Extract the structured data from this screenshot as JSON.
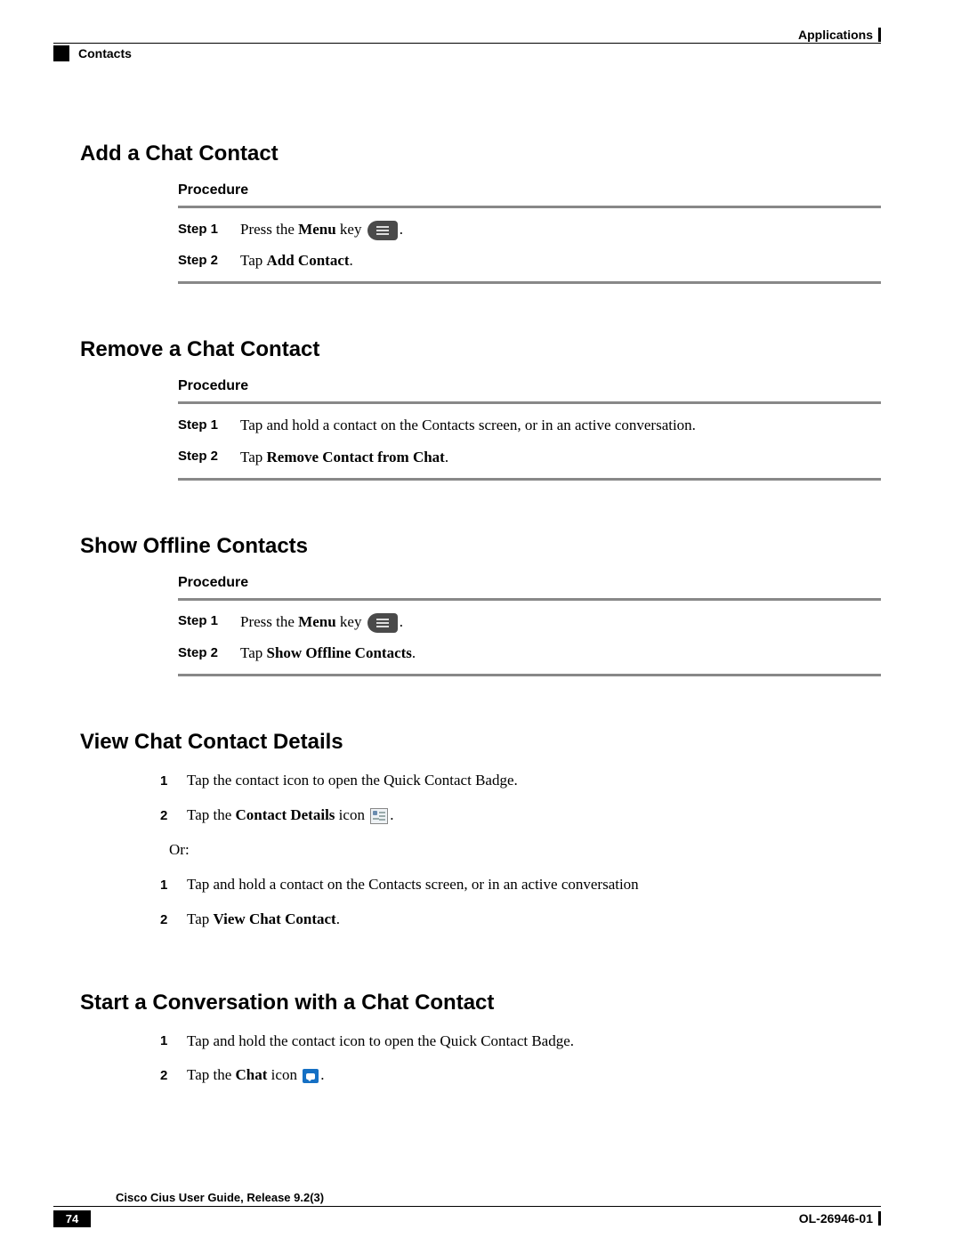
{
  "header": {
    "left": "Contacts",
    "right": "Applications"
  },
  "sections": {
    "add": {
      "title": "Add a Chat Contact",
      "procedure_label": "Procedure",
      "steps": [
        {
          "label": "Step 1",
          "prefix": "Press the ",
          "bold": "Menu",
          "suffix": " key ",
          "icon": "menu",
          "trail": "."
        },
        {
          "label": "Step 2",
          "prefix": "Tap ",
          "bold": "Add Contact",
          "suffix": ".",
          "icon": "",
          "trail": ""
        }
      ]
    },
    "remove": {
      "title": "Remove a Chat Contact",
      "procedure_label": "Procedure",
      "steps": [
        {
          "label": "Step 1",
          "prefix": "Tap and hold a contact on the Contacts screen, or in an active conversation.",
          "bold": "",
          "suffix": "",
          "icon": "",
          "trail": ""
        },
        {
          "label": "Step 2",
          "prefix": "Tap ",
          "bold": "Remove Contact from Chat",
          "suffix": ".",
          "icon": "",
          "trail": ""
        }
      ]
    },
    "offline": {
      "title": "Show Offline Contacts",
      "procedure_label": "Procedure",
      "steps": [
        {
          "label": "Step 1",
          "prefix": "Press the ",
          "bold": "Menu",
          "suffix": " key ",
          "icon": "menu",
          "trail": "."
        },
        {
          "label": "Step 2",
          "prefix": "Tap ",
          "bold": "Show Offline Contacts",
          "suffix": ".",
          "icon": "",
          "trail": ""
        }
      ]
    },
    "view": {
      "title": "View Chat Contact Details",
      "listA": [
        {
          "n": "1",
          "prefix": "Tap the contact icon to open the Quick Contact Badge.",
          "bold": "",
          "suffix": "",
          "icon": "",
          "trail": ""
        },
        {
          "n": "2",
          "prefix": "Tap the ",
          "bold": "Contact Details",
          "suffix": " icon ",
          "icon": "details",
          "trail": "."
        }
      ],
      "or": "Or:",
      "listB": [
        {
          "n": "1",
          "prefix": "Tap and hold a contact on the Contacts screen, or in an active conversation",
          "bold": "",
          "suffix": "",
          "icon": "",
          "trail": ""
        },
        {
          "n": "2",
          "prefix": "Tap ",
          "bold": "View Chat Contact",
          "suffix": ".",
          "icon": "",
          "trail": ""
        }
      ]
    },
    "start": {
      "title": "Start a Conversation with a Chat Contact",
      "list": [
        {
          "n": "1",
          "prefix": "Tap and hold the contact icon to open the Quick Contact Badge.",
          "bold": "",
          "suffix": "",
          "icon": "",
          "trail": ""
        },
        {
          "n": "2",
          "prefix": "Tap the ",
          "bold": "Chat",
          "suffix": " icon ",
          "icon": "chat",
          "trail": "."
        }
      ]
    }
  },
  "footer": {
    "guide": "Cisco Cius User Guide, Release 9.2(3)",
    "page": "74",
    "doc": "OL-26946-01"
  }
}
